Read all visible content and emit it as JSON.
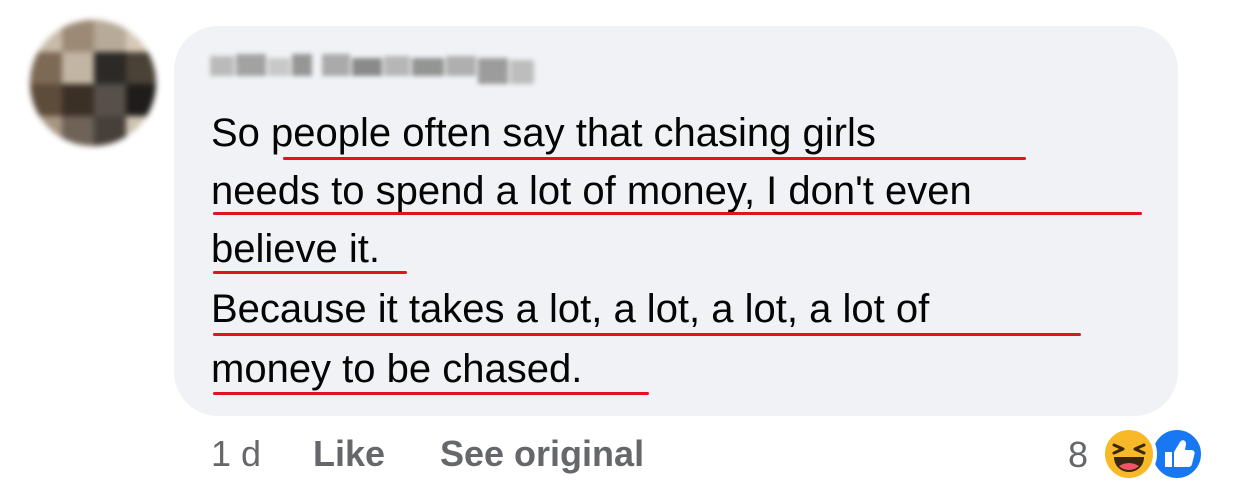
{
  "comment": {
    "lines": [
      "So people often say that chasing girls",
      "needs to spend a lot of money, I don't even",
      "believe it.",
      "Because it takes a lot, a lot, a lot, a lot of",
      "money to be chased."
    ]
  },
  "actions": {
    "time": "1 d",
    "like": "Like",
    "see_original": "See original"
  },
  "reactions": {
    "count": "8",
    "icons": [
      "haha-icon",
      "like-icon"
    ]
  },
  "colors": {
    "underline": "#e0141e",
    "bubble": "#f0f2f5",
    "text": "#050505",
    "meta": "#65676b",
    "like_blue": "#1877f2",
    "haha_yellow": "#f7b928"
  }
}
